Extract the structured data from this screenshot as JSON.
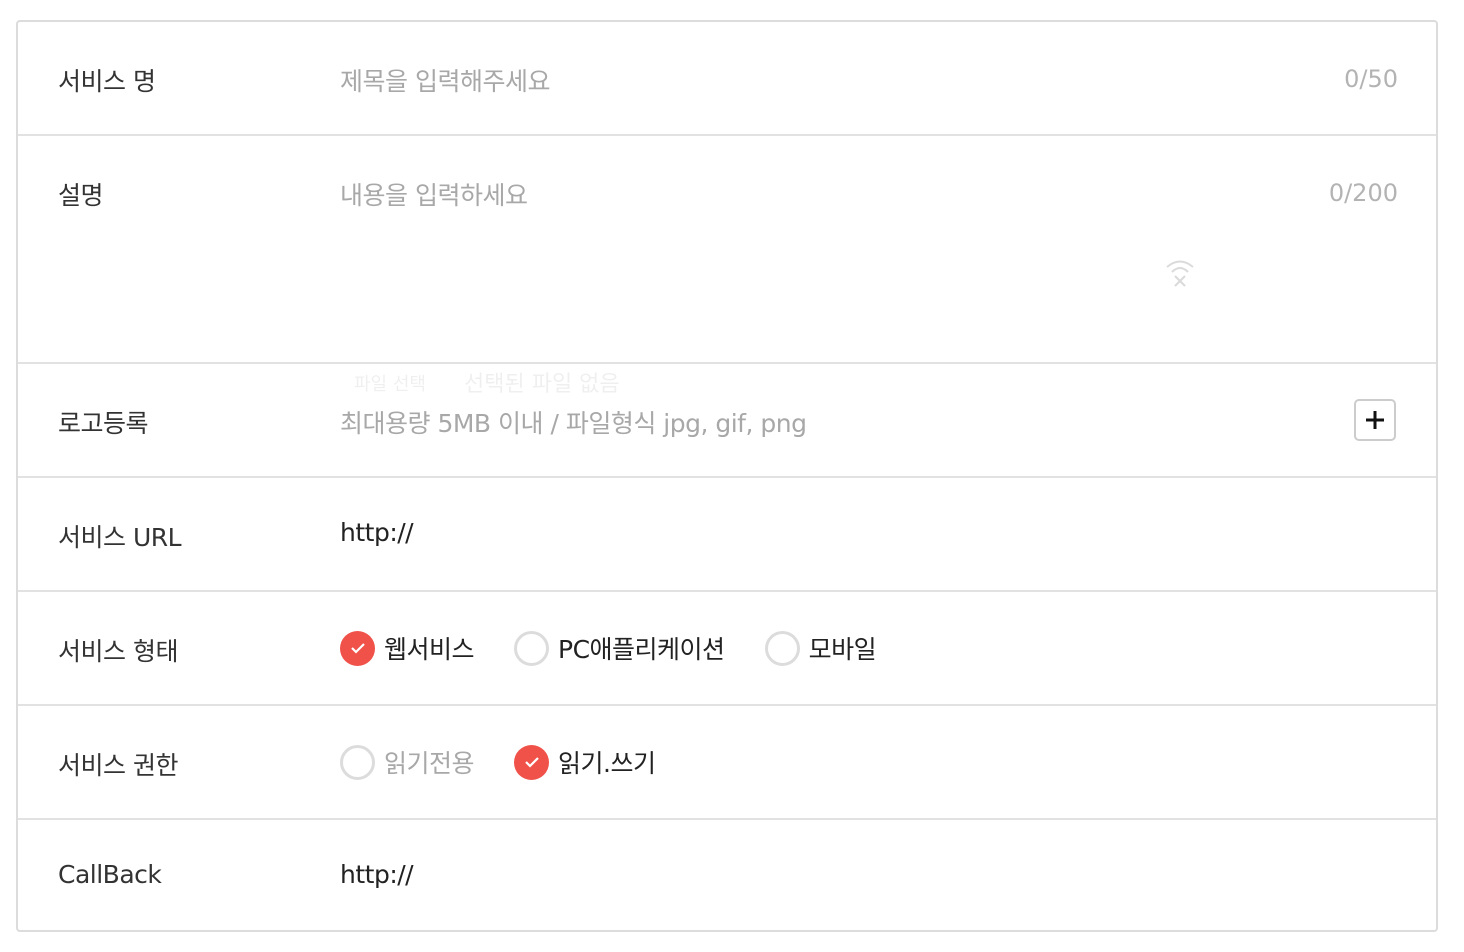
{
  "rows": {
    "service_name": {
      "label": "서비스 명",
      "placeholder": "제목을 입력해주세요",
      "counter": "0/50"
    },
    "description": {
      "label": "설명",
      "placeholder": "내용을 입력하세요",
      "counter": "0/200"
    },
    "logo": {
      "label": "로고등록",
      "hint": "최대용량 5MB 이내 / 파일형식 jpg, gif, png",
      "ghost_button": "파일 선택",
      "ghost_status": "선택된 파일 없음",
      "add_icon": "plus-icon"
    },
    "service_url": {
      "label": "서비스 URL",
      "value": "http://"
    },
    "service_type": {
      "label": "서비스 형태",
      "options": [
        {
          "label": "웹서비스",
          "checked": true
        },
        {
          "label": "PC애플리케이션",
          "checked": false
        },
        {
          "label": "모바일",
          "checked": false
        }
      ]
    },
    "service_permission": {
      "label": "서비스 권한",
      "options": [
        {
          "label": "읽기전용",
          "checked": false
        },
        {
          "label": "읽기.쓰기",
          "checked": true
        }
      ]
    },
    "callback": {
      "label": "CallBack",
      "value": "http://"
    }
  },
  "colors": {
    "accent": "#f05149",
    "border": "#dcdcdc",
    "placeholder": "#a8a8a8",
    "label": "#333333"
  }
}
